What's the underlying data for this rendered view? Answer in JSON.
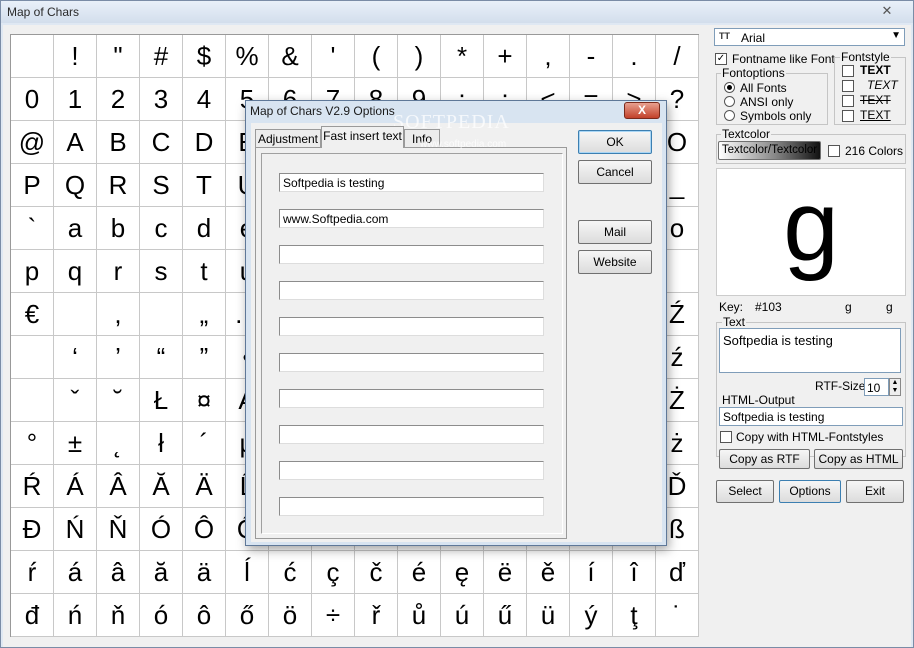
{
  "window": {
    "title": "Map of Chars",
    "close_glyph": "✕"
  },
  "grid": {
    "rows": [
      [
        "",
        "!",
        "\"",
        "#",
        "$",
        "%",
        "&",
        "'",
        "(",
        ")",
        "*",
        "+",
        ",",
        "-",
        ".",
        "/"
      ],
      [
        "0",
        "1",
        "2",
        "3",
        "4",
        "5",
        "6",
        "7",
        "8",
        "9",
        ":",
        ";",
        "<",
        "=",
        ">",
        "?"
      ],
      [
        "@",
        "A",
        "B",
        "C",
        "D",
        "E",
        "",
        "",
        "",
        "",
        "",
        "",
        "",
        "",
        "",
        "O"
      ],
      [
        "P",
        "Q",
        "R",
        "S",
        "T",
        "U",
        "",
        "",
        "",
        "",
        "",
        "",
        "",
        "",
        "",
        "_"
      ],
      [
        "`",
        "a",
        "b",
        "c",
        "d",
        "e",
        "",
        "",
        "",
        "",
        "",
        "",
        "",
        "",
        "",
        "o"
      ],
      [
        "p",
        "q",
        "r",
        "s",
        "t",
        "u",
        "",
        "",
        "",
        "",
        "",
        "",
        "",
        "",
        "",
        ""
      ],
      [
        "€",
        "",
        ",",
        "",
        "„",
        "…",
        "",
        "",
        "",
        "",
        "",
        "",
        "",
        "",
        "",
        "Ź"
      ],
      [
        "",
        "‘",
        "’",
        "“",
        "”",
        "•",
        "",
        "",
        "",
        "",
        "",
        "",
        "",
        "",
        "",
        "ź"
      ],
      [
        "",
        "ˇ",
        "˘",
        "Ł",
        "¤",
        "Ą",
        "",
        "",
        "",
        "",
        "",
        "",
        "",
        "",
        "",
        "Ż"
      ],
      [
        "°",
        "±",
        "˛",
        "ł",
        "´",
        "µ",
        "",
        "",
        "",
        "",
        "",
        "",
        "",
        "",
        "",
        "ż"
      ],
      [
        "Ŕ",
        "Á",
        "Â",
        "Ă",
        "Ä",
        "Ĺ",
        "",
        "",
        "",
        "",
        "",
        "",
        "",
        "",
        "",
        "Ď"
      ],
      [
        "Đ",
        "Ń",
        "Ň",
        "Ó",
        "Ô",
        "Ő",
        "",
        "",
        "",
        "",
        "",
        "",
        "",
        "",
        "",
        "ß"
      ],
      [
        "ŕ",
        "á",
        "â",
        "ă",
        "ä",
        "ĺ",
        "ć",
        "ç",
        "č",
        "é",
        "ę",
        "ë",
        "ě",
        "í",
        "î",
        "ď"
      ],
      [
        "đ",
        "ń",
        "ň",
        "ó",
        "ô",
        "ő",
        "ö",
        "÷",
        "ř",
        "ů",
        "ú",
        "ű",
        "ü",
        "ý",
        "ţ",
        "˙"
      ]
    ]
  },
  "font": {
    "icon": "TT",
    "name": "Arial",
    "fontname_like_font_label": "Fontname like Font",
    "fontname_like_font_checked": true
  },
  "fontoptions": {
    "label": "Fontoptions",
    "options": [
      "All Fonts",
      "ANSI only",
      "Symbols only"
    ],
    "selected": "All Fonts"
  },
  "fontstyle": {
    "label": "Fontstyle",
    "items": [
      "TEXT",
      "TEXT",
      "TEXT",
      "TEXT"
    ]
  },
  "textcolor": {
    "label": "Textcolor",
    "button": "Textcolor/Textcolor",
    "colors216_label": "216 Colors",
    "colors216_checked": false
  },
  "preview": {
    "char": "g",
    "key_label": "Key:",
    "key_code": "#103",
    "key_char1": "g",
    "key_char2": "g"
  },
  "text": {
    "label": "Text",
    "value": "Softpedia is testing",
    "rtf_label": "RTF-Size",
    "rtf_value": "10"
  },
  "html": {
    "label": "HTML-Output",
    "value": "Softpedia is testing",
    "copy_styles_label": "Copy with HTML-Fontstyles",
    "copy_styles_checked": false
  },
  "buttons": {
    "copy_rtf": "Copy as RTF",
    "copy_html": "Copy as HTML",
    "select": "Select",
    "options": "Options",
    "exit": "Exit"
  },
  "dialog": {
    "title": "Map of Chars V2.9 Options",
    "close_glyph": "X",
    "tabs": [
      "Adjustment",
      "Fast insert text",
      "Info"
    ],
    "active_tab": "Fast insert text",
    "inputs": [
      "Softpedia is testing",
      "www.Softpedia.com",
      "",
      "",
      "",
      "",
      "",
      "",
      "",
      ""
    ],
    "buttons": {
      "ok": "OK",
      "cancel": "Cancel",
      "mail": "Mail",
      "website": "Website"
    }
  },
  "watermark": {
    "text": "SOFTPEDIA",
    "url": "www.softpedia.com"
  }
}
